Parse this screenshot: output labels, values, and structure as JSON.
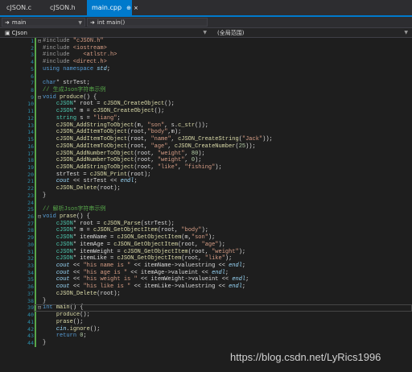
{
  "tabs": [
    {
      "label": "cJSON.c",
      "active": false
    },
    {
      "label": "cJSON.h",
      "active": false
    },
    {
      "label": "main.cpp",
      "active": true
    }
  ],
  "nav": {
    "project": "main",
    "function": "int main()"
  },
  "scope": {
    "left": "CJson",
    "right": "(全局范围)"
  },
  "colors": {
    "accent": "#007acc",
    "keyword": "#569cd6",
    "type": "#4ec9b0",
    "function": "#dcdcaa",
    "string": "#d69d85",
    "comment": "#57a64a",
    "number": "#b5cea8",
    "linenum": "#2b91af",
    "preproc": "#9b9b9b"
  },
  "code_lines": [
    {
      "n": "1",
      "text": "#include \"cJSON.h\""
    },
    {
      "n": "2",
      "text": "#include <iostream>"
    },
    {
      "n": "3",
      "text": "#include    <atlstr.h>"
    },
    {
      "n": "4",
      "text": "#include <direct.h>"
    },
    {
      "n": "5",
      "text": "using namespace std;"
    },
    {
      "n": "6",
      "text": ""
    },
    {
      "n": "7",
      "text": "char* strTest;"
    },
    {
      "n": "8",
      "text": "// 生成Json字符串示例"
    },
    {
      "n": "9",
      "text": "void produce() {"
    },
    {
      "n": "10",
      "text": "    cJSON* root = cJSON_CreateObject();"
    },
    {
      "n": "11",
      "text": "    cJSON* m = cJSON_CreateObject();"
    },
    {
      "n": "12",
      "text": "    string s = \"liang\";"
    },
    {
      "n": "13",
      "text": "    cJSON_AddStringToObject(m, \"son\", s.c_str());"
    },
    {
      "n": "14",
      "text": "    cJSON_AddItemToObject(root,\"body\",m);"
    },
    {
      "n": "15",
      "text": "    cJSON_AddItemToObject(root, \"name\", cJSON_CreateString(\"Jack\"));"
    },
    {
      "n": "16",
      "text": "    cJSON_AddItemToObject(root, \"age\", cJSON_CreateNumber(25));"
    },
    {
      "n": "17",
      "text": "    cJSON_AddNumberToObject(root, \"weight\", 80);"
    },
    {
      "n": "18",
      "text": "    cJSON_AddNumberToObject(root, \"weight\", 0);"
    },
    {
      "n": "19",
      "text": "    cJSON_AddStringToObject(root, \"like\", \"fishing\");"
    },
    {
      "n": "20",
      "text": "    strTest = cJSON_Print(root);"
    },
    {
      "n": "21",
      "text": "    cout << strTest << endl;"
    },
    {
      "n": "22",
      "text": "    cJSON_Delete(root);"
    },
    {
      "n": "23",
      "text": "}"
    },
    {
      "n": "24",
      "text": ""
    },
    {
      "n": "25",
      "text": "// 解析Json字符串示例"
    },
    {
      "n": "26",
      "text": "void prase() {"
    },
    {
      "n": "27",
      "text": "    cJSON* root = cJSON_Parse(strTest);"
    },
    {
      "n": "28",
      "text": "    cJSON* m = cJSON_GetObjectItem(root, \"body\");"
    },
    {
      "n": "29",
      "text": "    cJSON* itemName = cJSON_GetObjectItem(m,\"son\");"
    },
    {
      "n": "30",
      "text": "    cJSON* itemAge = cJSON_GetObjectItem(root, \"age\");"
    },
    {
      "n": "31",
      "text": "    cJSON* itemWeight = cJSON_GetObjectItem(root, \"weight\");"
    },
    {
      "n": "32",
      "text": "    cJSON* itemLike = cJSON_GetObjectItem(root, \"like\");"
    },
    {
      "n": "33",
      "text": "    cout << \"his name is \" << itemName->valuestring << endl;"
    },
    {
      "n": "34",
      "text": "    cout << \"his age is \" << itemAge->valueint << endl;"
    },
    {
      "n": "35",
      "text": "    cout << \"his weight is \" << itemWeight->valueint << endl;"
    },
    {
      "n": "36",
      "text": "    cout << \"his like is \" << itemLike->valuestring << endl;"
    },
    {
      "n": "37",
      "text": "    cJSON_Delete(root);"
    },
    {
      "n": "38",
      "text": "}"
    },
    {
      "n": "39",
      "text": "int main() {"
    },
    {
      "n": "40",
      "text": "    produce();"
    },
    {
      "n": "41",
      "text": "    prase();"
    },
    {
      "n": "42",
      "text": "    cin.ignore();"
    },
    {
      "n": "43",
      "text": "    return 0;"
    },
    {
      "n": "44",
      "text": "}"
    }
  ],
  "watermark": "https://blog.csdn.net/LyRics1996"
}
